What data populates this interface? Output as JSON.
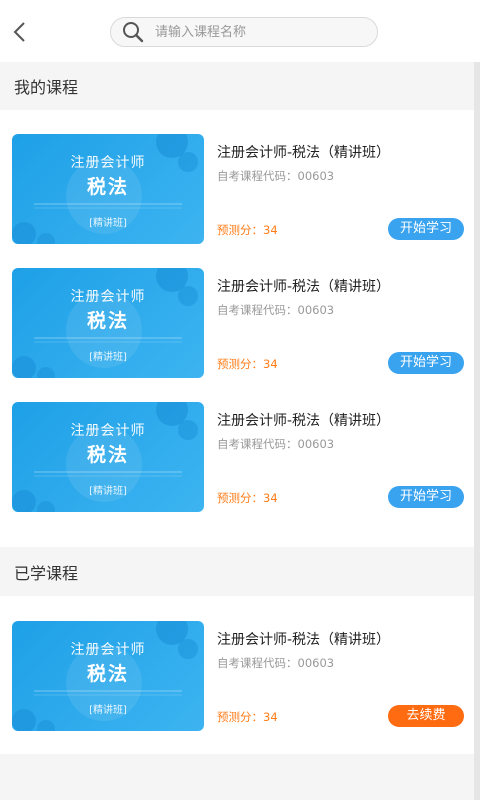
{
  "header": {
    "search_placeholder": "请输入课程名称"
  },
  "sections": {
    "my_courses_title": "我的课程",
    "studied_title": "已学课程"
  },
  "thumbnail": {
    "line1": "注册会计师",
    "line2": "税法",
    "line3": "[精讲班]"
  },
  "my_courses": [
    {
      "title": "注册会计师-税法（精讲班）",
      "code": "自考课程代码：00603",
      "score": "预测分：34",
      "button": "开始学习"
    },
    {
      "title": "注册会计师-税法（精讲班）",
      "code": "自考课程代码：00603",
      "score": "预测分：34",
      "button": "开始学习"
    },
    {
      "title": "注册会计师-税法（精讲班）",
      "code": "自考课程代码：00603",
      "score": "预测分：34",
      "button": "开始学习"
    }
  ],
  "studied_courses": [
    {
      "title": "注册会计师-税法（精讲班）",
      "code": "自考课程代码：00603",
      "score": "预测分：34",
      "button": "去续费"
    }
  ],
  "colors": {
    "accent_blue": "#3aa3ef",
    "accent_orange": "#ff6b10",
    "score_orange": "#ff7d1a"
  }
}
